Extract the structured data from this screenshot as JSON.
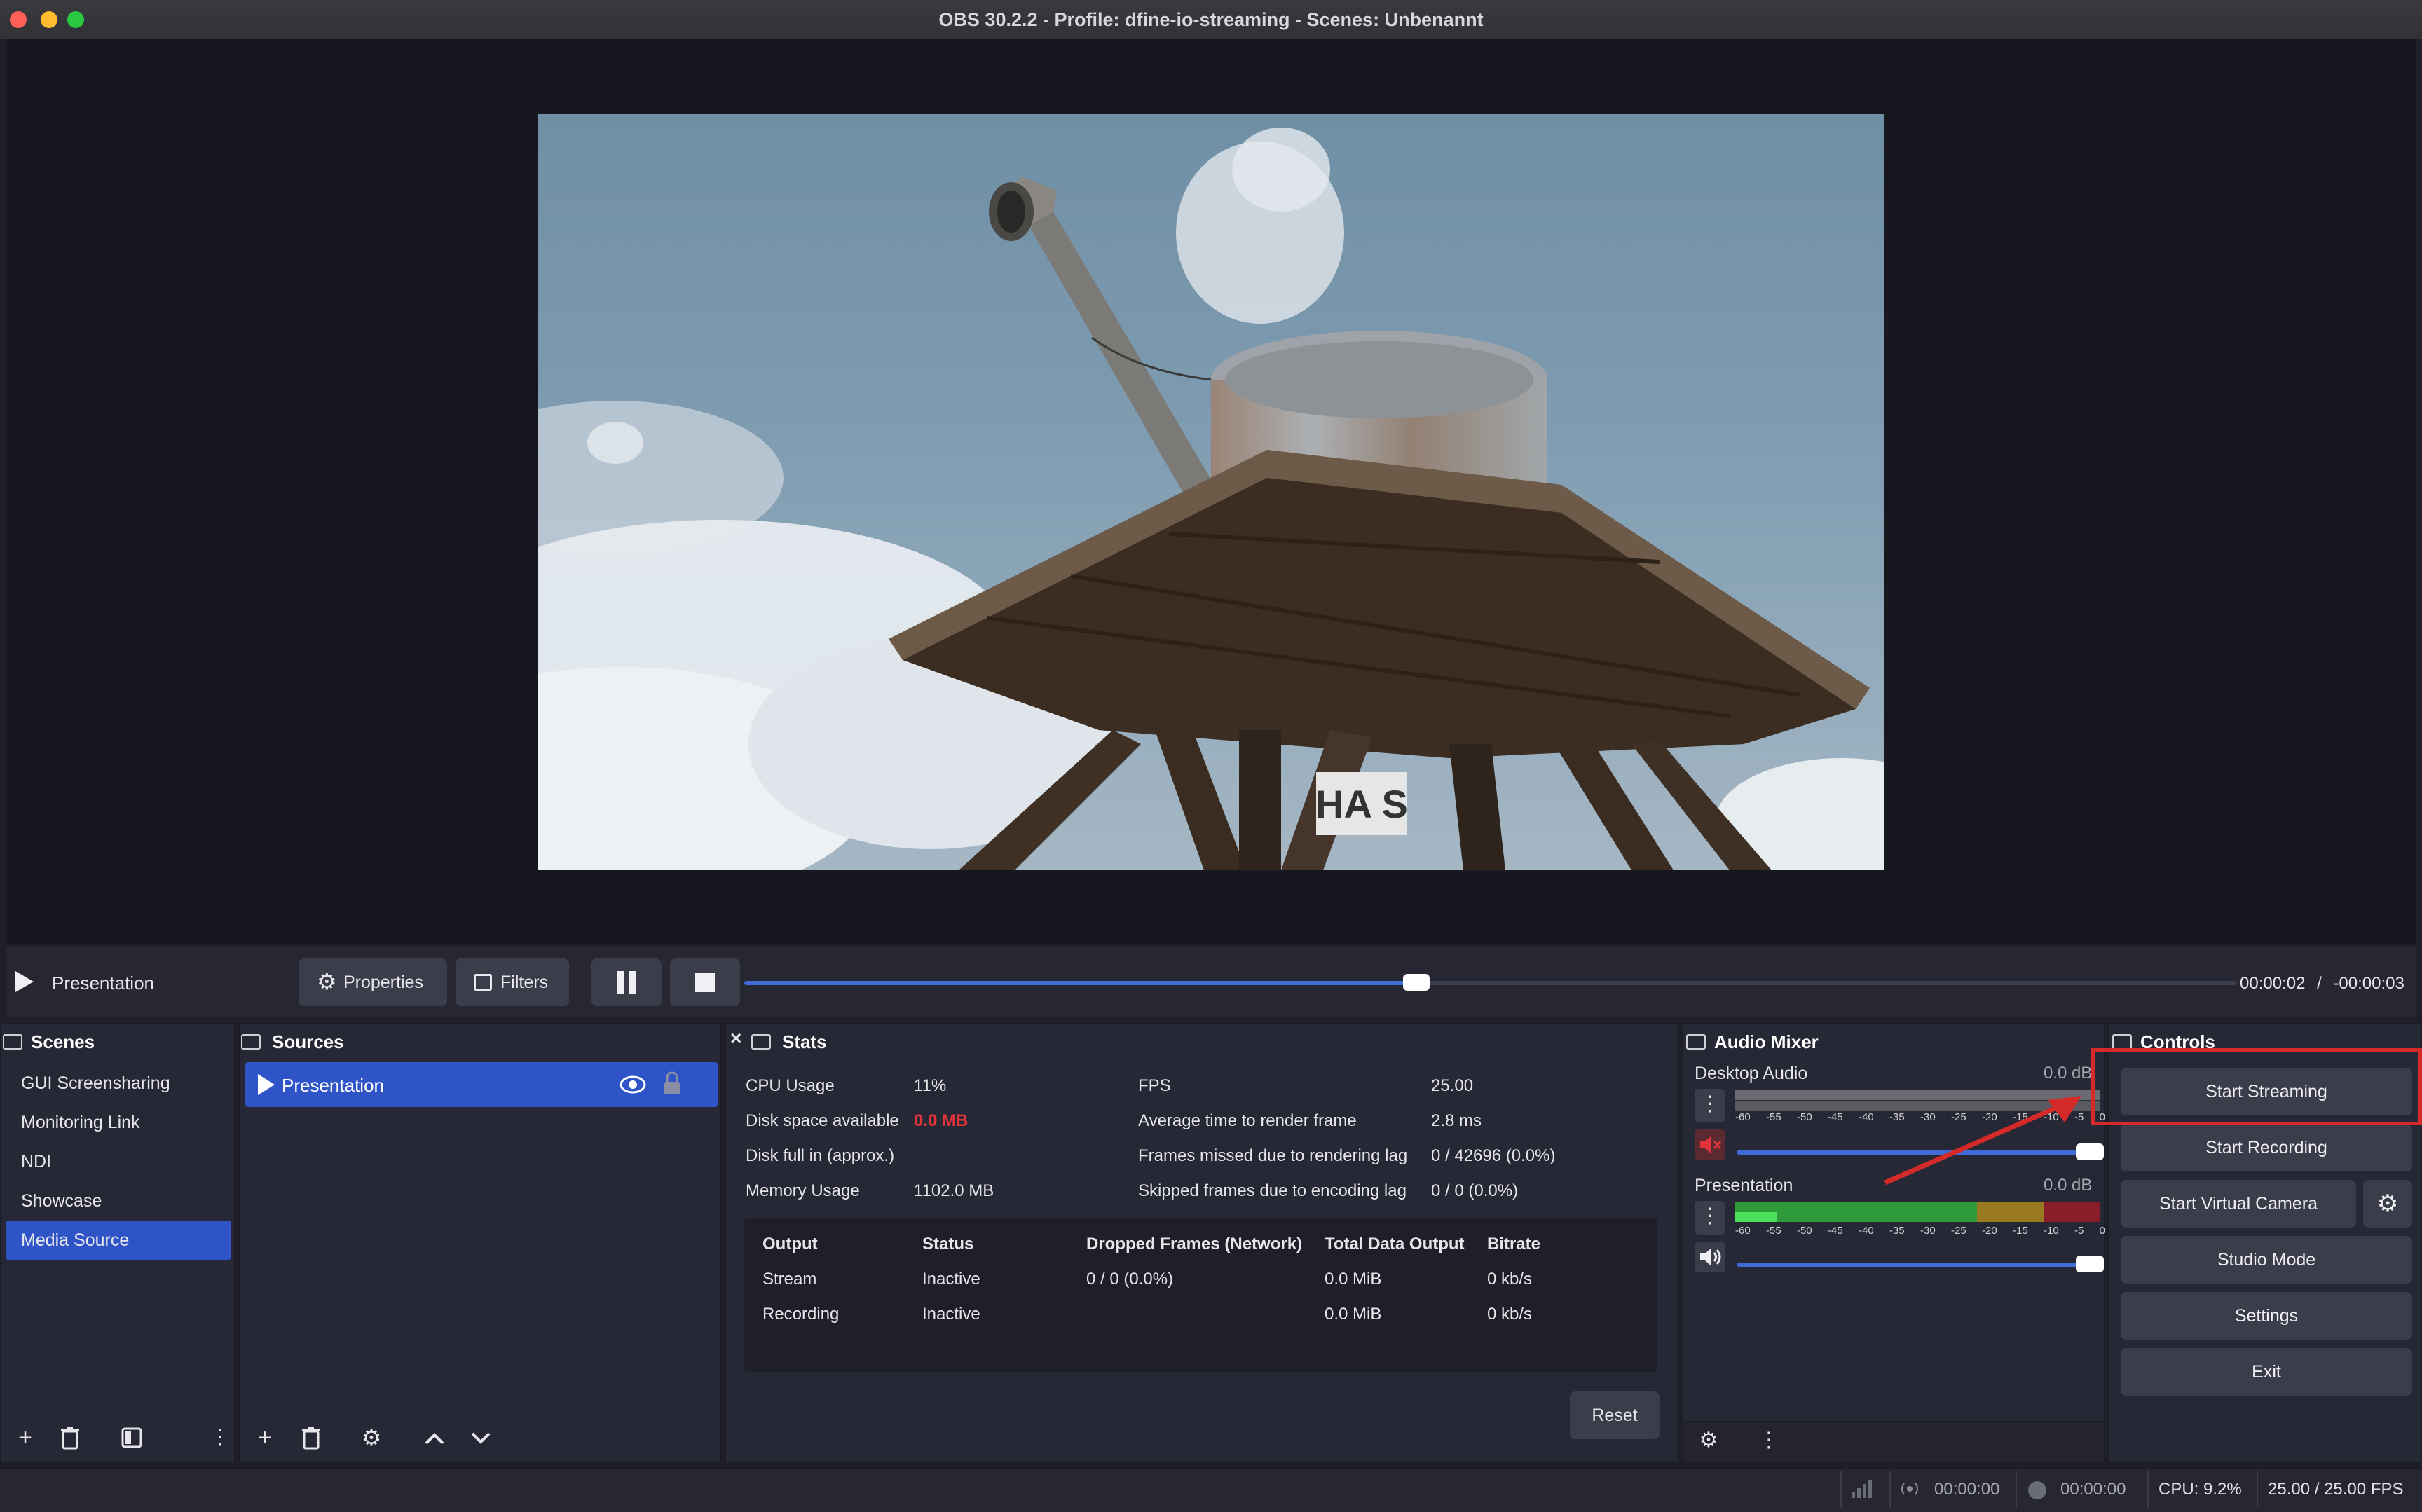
{
  "window": {
    "title": "OBS 30.2.2 - Profile: dfine-io-streaming - Scenes: Unbenannt"
  },
  "preview": {
    "video_sign_text": "HA S"
  },
  "media_controls": {
    "source_name": "Presentation",
    "properties_label": "Properties",
    "filters_label": "Filters",
    "progress": 0.45,
    "elapsed": "00:00:02",
    "separator": "/",
    "remaining": "-00:00:03"
  },
  "scenes": {
    "title": "Scenes",
    "items": [
      {
        "label": "GUI Screensharing"
      },
      {
        "label": "Monitoring Link"
      },
      {
        "label": "NDI"
      },
      {
        "label": "Showcase"
      },
      {
        "label": "Media Source",
        "selected": true
      }
    ]
  },
  "sources": {
    "title": "Sources",
    "items": [
      {
        "label": "Presentation",
        "selected": true
      }
    ]
  },
  "stats": {
    "title": "Stats",
    "left": [
      {
        "label": "CPU Usage",
        "value": "11%"
      },
      {
        "label": "Disk space available",
        "value": "0.0 MB",
        "color": "#e0343a"
      },
      {
        "label": "Disk full in (approx.)",
        "value": ""
      },
      {
        "label": "Memory Usage",
        "value": "1102.0 MB"
      }
    ],
    "right": [
      {
        "label": "FPS",
        "value": "25.00"
      },
      {
        "label": "Average time to render frame",
        "value": "2.8 ms"
      },
      {
        "label": "Frames missed due to rendering lag",
        "value": "0 / 42696 (0.0%)"
      },
      {
        "label": "Skipped frames due to encoding lag",
        "value": "0 / 0 (0.0%)"
      }
    ],
    "table": {
      "headers": [
        "Output",
        "Status",
        "Dropped Frames (Network)",
        "Total Data Output",
        "Bitrate"
      ],
      "rows": [
        [
          "Stream",
          "Inactive",
          "0 / 0 (0.0%)",
          "0.0 MiB",
          "0 kb/s"
        ],
        [
          "Recording",
          "Inactive",
          "",
          "0.0 MiB",
          "0 kb/s"
        ]
      ]
    },
    "reset_label": "Reset"
  },
  "audio_mixer": {
    "title": "Audio Mixer",
    "ticks": [
      "-60",
      "-55",
      "-50",
      "-45",
      "-40",
      "-35",
      "-30",
      "-25",
      "-20",
      "-15",
      "-10",
      "-5",
      "0"
    ],
    "channels": [
      {
        "name": "Desktop Audio",
        "level": "0.0 dB",
        "muted": true,
        "volume": 1.0
      },
      {
        "name": "Presentation",
        "level": "0.0 dB",
        "muted": false,
        "volume": 1.0
      }
    ]
  },
  "controls": {
    "title": "Controls",
    "start_streaming": "Start Streaming",
    "start_recording": "Start Recording",
    "start_virtual_camera": "Start Virtual Camera",
    "studio_mode": "Studio Mode",
    "settings": "Settings",
    "exit": "Exit"
  },
  "status_bar": {
    "stream_time": "00:00:00",
    "record_time": "00:00:00",
    "cpu": "CPU: 9.2%",
    "fps": "25.00 / 25.00 FPS"
  },
  "annotation_color": "#d42a2a",
  "accent_color": "#2f54c7"
}
